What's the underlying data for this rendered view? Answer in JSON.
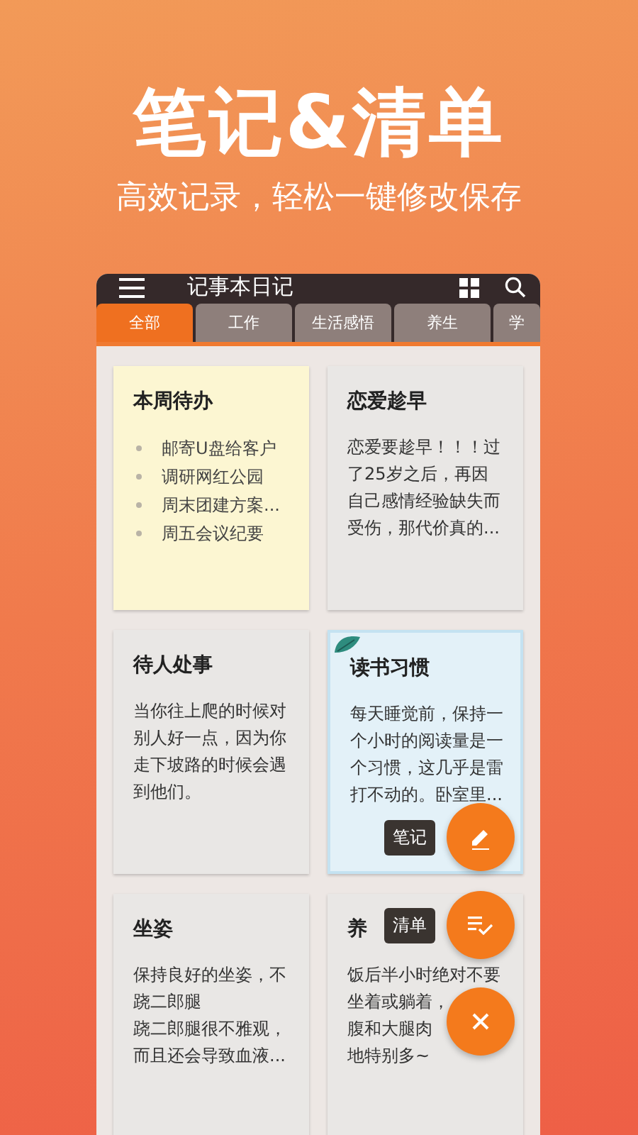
{
  "headline": "笔记&清单",
  "subtitle": "高效记录，轻松一键修改保存",
  "app_bar": {
    "title": "记事本日记"
  },
  "tabs": [
    {
      "label": "全部",
      "selected": true
    },
    {
      "label": "工作",
      "selected": false
    },
    {
      "label": "生活感悟",
      "selected": false
    },
    {
      "label": "养生",
      "selected": false
    },
    {
      "label": "学",
      "selected": false
    }
  ],
  "cards": [
    {
      "kind": "list",
      "title": "本周待办",
      "color": "#fcf6d2",
      "decorated": false,
      "lines": [
        "邮寄U盘给客户",
        "调研网红公园",
        "周末团建方案...",
        "周五会议纪要"
      ]
    },
    {
      "kind": "text",
      "title": "恋爱趁早",
      "color": "#e9e7e5",
      "decorated": false,
      "lines": [
        "恋爱要趁早！！！过",
        "了25岁之后，再因",
        "自己感情经验缺失而",
        "受伤，那代价真的..."
      ]
    },
    {
      "kind": "text",
      "title": "待人处事",
      "color": "#e9e7e5",
      "decorated": false,
      "lines": [
        "当你往上爬的时候对",
        "别人好一点，因为你",
        "走下坡路的时候会遇",
        "到他们。"
      ]
    },
    {
      "kind": "text",
      "title": "读书习惯",
      "color": "#e3f1f8",
      "decorated": true,
      "lines": [
        "每天睡觉前，保持一",
        "个小时的阅读量是一",
        "个习惯，这几乎是雷",
        "打不动的。卧室里..."
      ]
    },
    {
      "kind": "text",
      "title": "坐姿",
      "color": "#e9e7e5",
      "decorated": false,
      "lines": [
        "保持良好的坐姿，不",
        "跷二郎腿",
        "跷二郎腿很不雅观，",
        "而且还会导致血液..."
      ]
    },
    {
      "kind": "text",
      "title": "养",
      "color": "#e9e7e5",
      "decorated": false,
      "lines": [
        "饭后半小时绝对不要",
        "坐着或躺着，",
        "腹和大腿肉",
        "地特别多~"
      ]
    }
  ],
  "fab_menu": [
    {
      "kind": "note",
      "label": "笔记"
    },
    {
      "kind": "list",
      "label": "清单"
    },
    {
      "kind": "close"
    }
  ]
}
